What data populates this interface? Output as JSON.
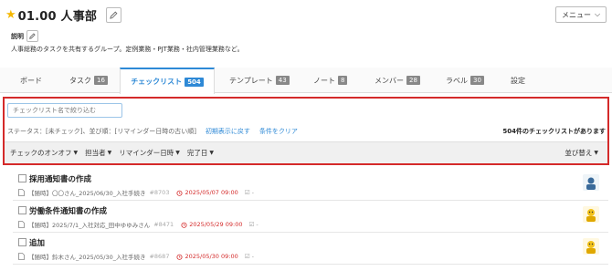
{
  "header": {
    "title": "01.00 人事部",
    "menu_label": "メニュー"
  },
  "description": {
    "label": "説明",
    "text": "人事総務のタスクを共有するグループ。定例業務・PJT業務・社内管理業務など。"
  },
  "tabs": [
    {
      "label": "ボード",
      "count": ""
    },
    {
      "label": "タスク",
      "count": "16"
    },
    {
      "label": "チェックリスト",
      "count": "504"
    },
    {
      "label": "テンプレート",
      "count": "43"
    },
    {
      "label": "ノート",
      "count": "8"
    },
    {
      "label": "メンバー",
      "count": "28"
    },
    {
      "label": "ラベル",
      "count": "30"
    },
    {
      "label": "設定",
      "count": ""
    }
  ],
  "search": {
    "placeholder": "チェックリスト名で絞り込む"
  },
  "status": {
    "text": "ステータス：[未チェック]、並び順：[リマインダー日時の古い順]",
    "reset_link": "初期表示に戻す",
    "clear_link": "条件をクリア",
    "count_text": "504件のチェックリストがあります"
  },
  "filters": {
    "check_onoff": "チェックのオンオフ",
    "assignee": "担当者",
    "reminder": "リマインダー日時",
    "done_date": "完了日",
    "sort": "並び替え"
  },
  "items": [
    {
      "title": "採用通知書の作成",
      "meta": "【随時】〇〇さん_2025/06/30_入社手続き",
      "num": "#8703",
      "reminder": "2025/05/07 09:00",
      "check": "-"
    },
    {
      "title": "労働条件通知書の作成",
      "meta": "【随時】2025/7/1_入社対応_田中ゆゆみさん",
      "num": "#8471",
      "reminder": "2025/05/29 09:00",
      "check": "-"
    },
    {
      "title": "追加",
      "meta": "【随時】鈴木さん_2025/05/30_入社手続き",
      "num": "#8687",
      "reminder": "2025/05/30 09:00",
      "check": "-"
    }
  ],
  "colors": {
    "accent": "#2e89d6",
    "highlight_border": "#d42a2a",
    "star": "#f5b800",
    "reminder": "#d42a2a"
  }
}
